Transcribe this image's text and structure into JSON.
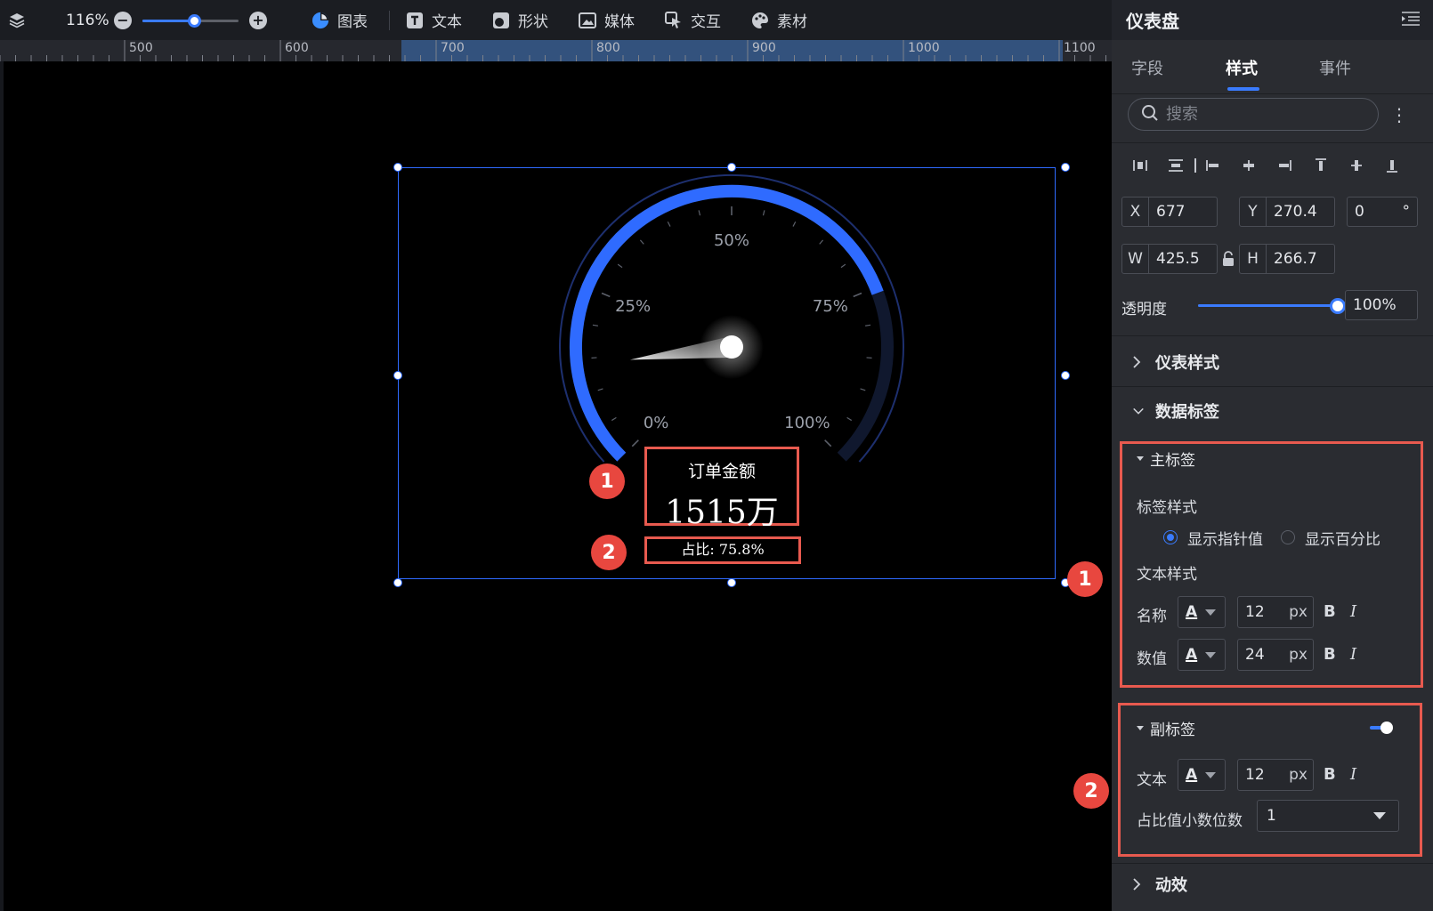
{
  "toolbar": {
    "zoom": "116%",
    "zoom_level": 0.55,
    "items": [
      {
        "label": "图表",
        "icon": "pie-chart-icon"
      },
      {
        "label": "文本",
        "icon": "text-icon"
      },
      {
        "label": "形状",
        "icon": "shape-icon"
      },
      {
        "label": "媒体",
        "icon": "image-icon"
      },
      {
        "label": "交互",
        "icon": "pointer-icon"
      },
      {
        "label": "素材",
        "icon": "palette-icon"
      }
    ]
  },
  "ruler": {
    "labels": [
      "500",
      "600",
      "700",
      "800",
      "900",
      "1000",
      "1100"
    ]
  },
  "gauge": {
    "ticks": [
      "0%",
      "25%",
      "50%",
      "75%",
      "100%"
    ],
    "value_fraction": 0.758,
    "main_name": "订单金额",
    "main_value": "1515万",
    "sub_label": "占比: 75.8%",
    "accent": "#2f6bff"
  },
  "callouts": [
    "1",
    "2",
    "1",
    "2"
  ],
  "panel": {
    "title": "仪表盘",
    "tabs": [
      "字段",
      "样式",
      "事件"
    ],
    "active_tab": "样式",
    "search_placeholder": "搜索",
    "x_label": "X",
    "x_value": "677",
    "y_label": "Y",
    "y_value": "270.4",
    "rotation_value": "0",
    "rotation_unit": "°",
    "w_label": "W",
    "w_value": "425.5",
    "h_label": "H",
    "h_value": "266.7",
    "opacity_label": "透明度",
    "opacity_value": "100%",
    "opacity_level": 1.0,
    "section_gauge_style": "仪表样式",
    "section_data_label": "数据标签",
    "main_label": {
      "title": "主标签",
      "style_label": "标签样式",
      "option_pointer": "显示指针值",
      "option_percent": "显示百分比",
      "text_style_label": "文本样式",
      "name_label": "名称",
      "name_size": "12",
      "value_label": "数值",
      "value_size": "24"
    },
    "sub_label": {
      "title": "副标签",
      "enabled": true,
      "text_label": "文本",
      "text_size": "12",
      "decimals_label": "占比值小数位数",
      "decimals_value": "1"
    },
    "section_animation": "动效",
    "unit_px": "px",
    "bold": "B",
    "italic": "I",
    "color_glyph": "A"
  }
}
